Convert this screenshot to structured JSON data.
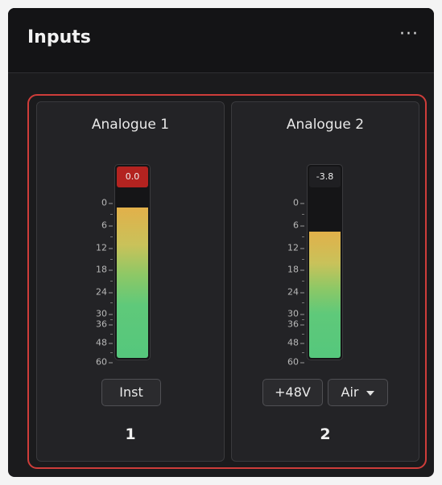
{
  "header": {
    "title": "Inputs",
    "more_icon": "more-horizontal-icon",
    "more_glyph": "···"
  },
  "scale_labels": [
    "0",
    "6",
    "12",
    "18",
    "24",
    "30",
    "36",
    "48",
    "60"
  ],
  "colors": {
    "accent_border": "#cf3d3a",
    "clip_red": "#b32320",
    "meter_green": "#55c77c",
    "meter_yellow": "#e2b04a"
  },
  "channels": [
    {
      "name": "Analogue 1",
      "number": "1",
      "peak_label": "0.0",
      "clipping": true,
      "level_fraction": 0.88,
      "buttons": [
        {
          "label": "Inst"
        }
      ]
    },
    {
      "name": "Analogue 2",
      "number": "2",
      "peak_label": "-3.8",
      "clipping": false,
      "level_fraction": 0.74,
      "buttons": [
        {
          "label": "+48V"
        }
      ],
      "air_select": {
        "label": "Air",
        "icon": "chevron-down-icon"
      }
    }
  ]
}
